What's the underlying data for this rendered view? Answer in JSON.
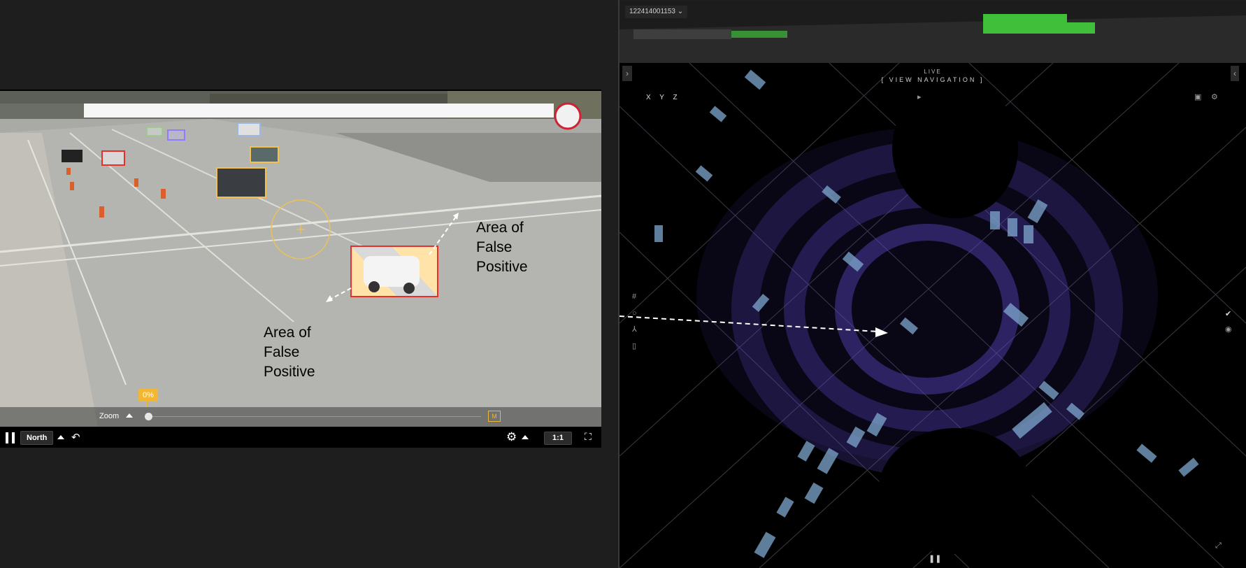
{
  "camera": {
    "view_label": "North",
    "zoom_label": "Zoom",
    "zoom_percent": "0%",
    "zoom_value": 0,
    "ratio_label": "1:1",
    "annotations": {
      "top_right": "Area of\nFalse\nPositive",
      "bottom_left": "Area of\nFalse\nPositive"
    },
    "icons": {
      "pause": "pause-icon",
      "view_up": "caret-up-icon",
      "back": "back-arrow-icon",
      "settings": "gear-icon",
      "fullscreen": "fullscreen-icon",
      "manual": "manual-mode-icon",
      "crosshair": "crosshair-icon"
    },
    "colors": {
      "highlight_box": "#e8302a",
      "tracked_box": "#f2c14e",
      "violet_box": "#8f7cff",
      "false_positive_fill": "#ffe3a8"
    }
  },
  "lidar": {
    "sensor_id": "122414001153",
    "live_label": "LIVE",
    "view_navigation_label": "[ VIEW NAVIGATION ]",
    "axes": "X Y Z",
    "icons": {
      "collapse": "chevron-right-icon",
      "grid": "grid-icon",
      "axis": "axis-icon",
      "layers": "layers-icon",
      "check": "check-icon",
      "screenshot": "image-icon"
    },
    "colors": {
      "point_cloud": "#6e5bd8",
      "vehicle_box": "#7fa8d0",
      "truck": "#3fbf3a"
    }
  }
}
